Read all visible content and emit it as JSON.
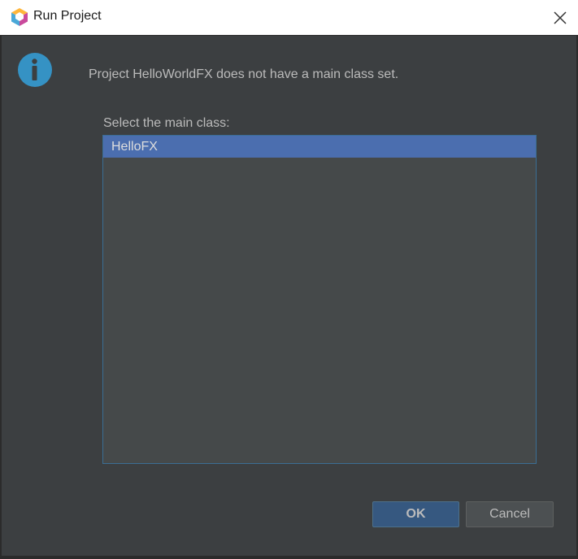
{
  "window": {
    "title": "Run Project",
    "app_icon": "netbeans-cube-icon",
    "close_icon": "close-icon"
  },
  "dialog": {
    "icon": "info-icon",
    "message": "Project HelloWorldFX does not have a main class set.",
    "list_label": "Select the main class:",
    "items": [
      {
        "label": "HelloFX",
        "selected": true
      }
    ]
  },
  "buttons": {
    "ok_label": "OK",
    "cancel_label": "Cancel"
  },
  "colors": {
    "background": "#3c3f41",
    "text": "#bbbbbb",
    "selection": "#4b6eaf",
    "list_background": "#45494a",
    "ok_button": "#365880",
    "info_icon": "#3592c4"
  }
}
